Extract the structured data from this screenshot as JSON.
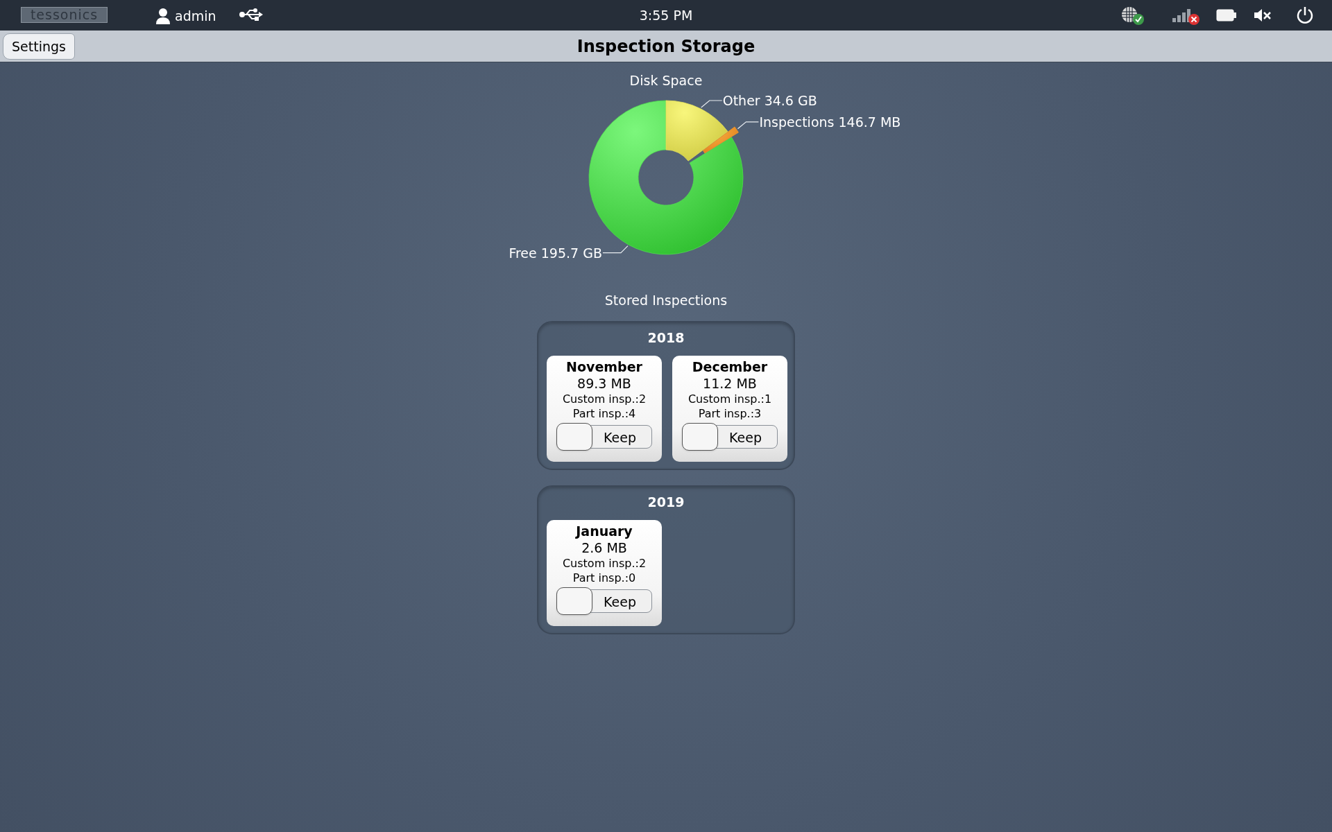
{
  "top_bar": {
    "logo": "tessonics",
    "user": "admin",
    "time": "3:55 PM"
  },
  "header": {
    "back_button": "Settings",
    "title": "Inspection Storage"
  },
  "disk_space": {
    "title": "Disk Space",
    "segments": [
      {
        "category": "Free",
        "amount": "195.7 GB",
        "color": "#4fdc4f"
      },
      {
        "category": "Other",
        "amount": "34.6 GB",
        "color": "#e6e35a"
      },
      {
        "category": "Inspections",
        "amount": "146.7 MB",
        "color": "#f0962a"
      }
    ]
  },
  "stored_inspections": {
    "title": "Stored Inspections",
    "years": [
      {
        "year": "2018",
        "months": [
          {
            "month": "November",
            "size": "89.3 MB",
            "custom": "Custom insp.:2",
            "part": "Part insp.:4",
            "toggle_label": "Keep",
            "keep": false
          },
          {
            "month": "December",
            "size": "11.2 MB",
            "custom": "Custom insp.:1",
            "part": "Part insp.:3",
            "toggle_label": "Keep",
            "keep": false
          }
        ]
      },
      {
        "year": "2019",
        "months": [
          {
            "month": "January",
            "size": "2.6 MB",
            "custom": "Custom insp.:2",
            "part": "Part insp.:0",
            "toggle_label": "Keep",
            "keep": false
          }
        ]
      }
    ]
  }
}
